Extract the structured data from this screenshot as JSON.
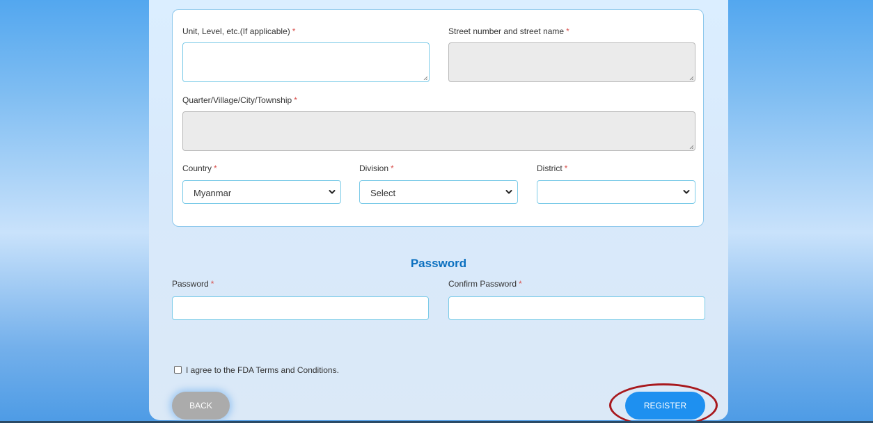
{
  "address": {
    "unit_label": "Unit, Level, etc.(If applicable)",
    "street_label": "Street number and street name",
    "quarter_label": "Quarter/Village/City/Township",
    "country_label": "Country",
    "country_value": "Myanmar",
    "division_label": "Division",
    "division_value": "Select",
    "district_label": "District",
    "district_value": "",
    "required_mark": "*"
  },
  "password_section": {
    "title": "Password",
    "password_label": "Password",
    "confirm_label": "Confirm Password",
    "required_mark": "*"
  },
  "terms": {
    "label": "I agree to the FDA Terms and Conditions.",
    "checked": false
  },
  "actions": {
    "back_label": "BACK",
    "register_label": "REGISTER"
  },
  "icons": {
    "select_arrow": "chevron-down-icon",
    "resize": "resize-grip-icon"
  },
  "colors": {
    "required": "#d9534f",
    "section_title": "#0a6fbf",
    "register_button": "#1e90f0",
    "back_button": "#ababab",
    "highlight": "#a8191e"
  }
}
